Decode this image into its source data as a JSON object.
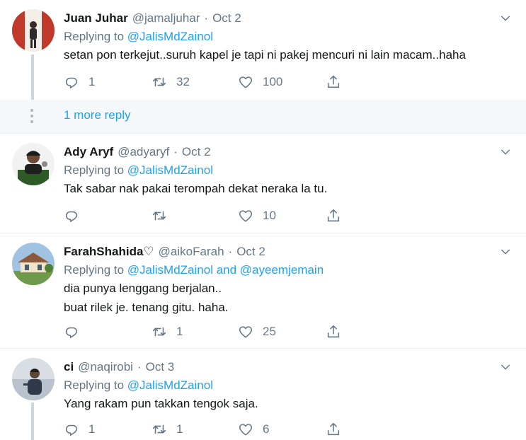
{
  "tweets": [
    {
      "name": "Juan Juhar",
      "handle": "@jamaljuhar",
      "date": "Oct 2",
      "replying_prefix": "Replying to ",
      "mentions": [
        "@JalisMdZainol"
      ],
      "conjunction": "",
      "text_lines": [
        "setan pon terkejut..suruh kapel je tapi ni pakej mencuri ni lain macam..haha"
      ],
      "replies": "1",
      "retweets": "32",
      "likes": "100"
    },
    {
      "name": "Ady Aryf",
      "handle": "@adyaryf",
      "date": "Oct 2",
      "replying_prefix": "Replying to ",
      "mentions": [
        "@JalisMdZainol"
      ],
      "conjunction": "",
      "text_lines": [
        "Tak sabar nak pakai terompah dekat neraka la tu."
      ],
      "replies": "",
      "retweets": "",
      "likes": "10"
    },
    {
      "name": "FarahShahida♡",
      "handle": "@aikoFarah",
      "date": "Oct 2",
      "replying_prefix": "Replying to ",
      "mentions": [
        "@JalisMdZainol",
        "@ayeemjemain"
      ],
      "conjunction": " and ",
      "text_lines": [
        "dia punya lenggang berjalan..",
        "buat rilek je. tenang gitu. haha."
      ],
      "replies": "",
      "retweets": "1",
      "likes": "25"
    },
    {
      "name": "ci",
      "handle": "@naqirobi",
      "date": "Oct 3",
      "replying_prefix": "Replying to ",
      "mentions": [
        "@JalisMdZainol"
      ],
      "conjunction": "",
      "text_lines": [
        "Yang rakam pun takkan tengok saja."
      ],
      "replies": "1",
      "retweets": "1",
      "likes": "6"
    }
  ],
  "more_reply": {
    "label": "1 more reply"
  },
  "separator_dot": "·",
  "icons": {
    "reply": "reply-icon",
    "retweet": "retweet-icon",
    "like": "heart-icon",
    "share": "share-icon",
    "more": "chevron-down-icon"
  },
  "colors": {
    "link": "#1da1f2",
    "secondary_text": "#657786",
    "primary_text": "#14171a",
    "border": "#e6ecf0",
    "thread_line": "#ccd6dd",
    "more_bg": "#f5f8fa"
  }
}
